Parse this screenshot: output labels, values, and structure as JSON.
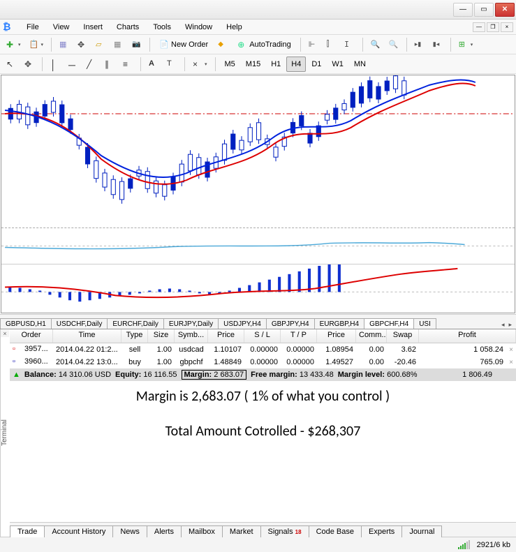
{
  "menu": [
    "File",
    "View",
    "Insert",
    "Charts",
    "Tools",
    "Window",
    "Help"
  ],
  "toolbar1": {
    "new_order": "New Order",
    "auto_trading": "AutoTrading"
  },
  "timeframes": [
    "M5",
    "M15",
    "H1",
    "H4",
    "D1",
    "W1",
    "MN"
  ],
  "active_timeframe": "H4",
  "chart_tabs": [
    "GBPUSD,H1",
    "USDCHF,Daily",
    "EURCHF,Daily",
    "EURJPY,Daily",
    "USDJPY,H4",
    "GBPJPY,H4",
    "EURGBP,H4",
    "GBPCHF,H4",
    "USI"
  ],
  "active_chart_tab": "GBPCHF,H4",
  "terminal_label": "Terminal",
  "table": {
    "headers": [
      "Order",
      "Time",
      "Type",
      "Size",
      "Symb...",
      "Price",
      "S / L",
      "T / P",
      "Price",
      "Comm...",
      "Swap",
      "Profit"
    ],
    "rows": [
      {
        "icon": "sell",
        "order": "3957...",
        "time": "2014.04.22 01:2...",
        "type": "sell",
        "size": "1.00",
        "symbol": "usdcad",
        "price": "1.10107",
        "sl": "0.00000",
        "tp": "0.00000",
        "price2": "1.08954",
        "comm": "0.00",
        "swap": "3.62",
        "profit": "1 058.24"
      },
      {
        "icon": "buy",
        "order": "3960...",
        "time": "2014.04.22 13:0...",
        "type": "buy",
        "size": "1.00",
        "symbol": "gbpchf",
        "price": "1.48849",
        "sl": "0.00000",
        "tp": "0.00000",
        "price2": "1.49527",
        "comm": "0.00",
        "swap": "-20.46",
        "profit": "765.09"
      }
    ],
    "summary": {
      "balance_lbl": "Balance:",
      "balance": "14 310.06 USD",
      "equity_lbl": "Equity:",
      "equity": "16 116.55",
      "margin_lbl": "Margin:",
      "margin": "2 683.07",
      "free_lbl": "Free margin:",
      "free": "13 433.48",
      "level_lbl": "Margin level:",
      "level": "600.68%",
      "profit": "1 806.49"
    }
  },
  "annotations": {
    "line1": "Margin is 2,683.07   ( 1% of what you control )",
    "line2": "Total Amount Cotrolled - $268,307"
  },
  "term_tabs": [
    "Trade",
    "Account History",
    "News",
    "Alerts",
    "Mailbox",
    "Market",
    "Signals",
    "Code Base",
    "Experts",
    "Journal"
  ],
  "signals_count": "18",
  "status": {
    "conn": "2921/6 kb"
  },
  "chart_data": {
    "type": "candlestick",
    "symbol": "GBPCHF",
    "timeframe": "H4",
    "note": "Candlestick price chart with two moving averages (red slower, blue faster), a horizontal dash-dot reference line, an oscillator sub-window (light blue line near midline), and a MACD-style histogram with red signal line. Values below are approximate pixel-estimates as no axis labels are shown.",
    "approx_range": {
      "low": 1.455,
      "high": 1.5
    },
    "reference_line": 1.489,
    "overlays": [
      {
        "name": "MA fast",
        "color": "#0022dd"
      },
      {
        "name": "MA slow",
        "color": "#dd0000"
      }
    ],
    "indicator_windows": [
      {
        "name": "oscillator",
        "type": "line",
        "color": "#4aa8d8"
      },
      {
        "name": "MACD",
        "type": "histogram+line",
        "hist_color": "#1030d0",
        "signal_color": "#dd0000"
      }
    ]
  }
}
